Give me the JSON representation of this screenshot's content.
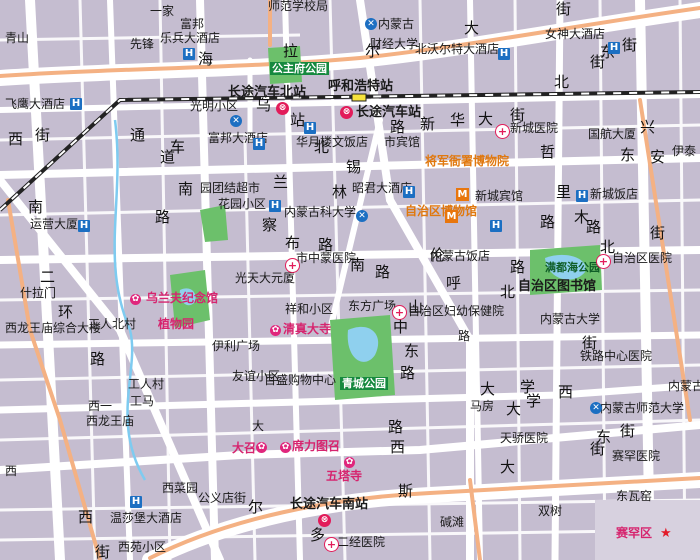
{
  "colors": {
    "block": "#c5bdd0",
    "road": "#ffffff",
    "arterial": "#f4b183",
    "water": "#8fd0ee",
    "park": "#6cc06b",
    "rail": "#222222",
    "canal": "#7ecbf0"
  },
  "roads": {
    "hailaer": [
      "海",
      "拉",
      "尔",
      "大",
      "街"
    ],
    "hailaer_east": [
      "东",
      "街"
    ],
    "xinhua": [
      "新",
      "华",
      "大",
      "街"
    ],
    "zhongshan": [
      "中",
      "山",
      "东",
      "路"
    ],
    "daxue": [
      "大",
      "学",
      "东",
      "街"
    ],
    "nan_erhuan": [
      "南",
      "二",
      "环",
      "路"
    ],
    "erdong": [
      "尔",
      "多",
      "斯",
      "大",
      "街"
    ],
    "xinhua_west": [
      "西",
      "街"
    ],
    "tongdao": [
      "通",
      "道",
      "南",
      "路"
    ],
    "wulanchabu": [
      "乌",
      "兰",
      "察",
      "布",
      "路"
    ],
    "shiyan": [
      "锡",
      "林",
      "南",
      "路"
    ],
    "xilin_west": [
      "西",
      "街"
    ],
    "huang": [
      "西",
      "路"
    ],
    "dongfeng": [
      "大",
      "学",
      "西",
      "街"
    ],
    "hulunbeier": [
      "呼",
      "伦",
      "北",
      "路"
    ],
    "zhelimu": [
      "哲",
      "里",
      "木",
      "路"
    ],
    "xingan": [
      "兴",
      "安",
      "北",
      "路"
    ],
    "beijing": [
      "北",
      "街"
    ],
    "nan_che": [
      "车",
      "站",
      "北",
      "路"
    ],
    "ruyi": [
      "东",
      "街"
    ]
  },
  "places": {
    "qingshan": "青山",
    "yijia": "一家",
    "xianfeng": "先锋",
    "fubang": "富邦",
    "lebing": "乐兵大酒店",
    "shifan": "师范学校局",
    "neimenggu": "内蒙古",
    "caijing": "财经大学",
    "nvshen": "女神大酒店",
    "hawo": "北沃尔特大酒店",
    "feiying": "飞鹰大酒店",
    "guangming": "光明小区",
    "huhehaote_station": "呼和浩特站",
    "changtu_bei": "长途汽车北站",
    "changtu": "长途汽车站",
    "gongzhufu": "公主府公园",
    "xincheng_yy": "新城医院",
    "guohang": "国航大厦",
    "yiji": "伊泰",
    "fubang2": "富邦大酒店",
    "hualou": "华月楼文饭店",
    "shibin": "市宾馆",
    "jiangjun": "将军衙署博物院",
    "xincheng_bg": "新城宾馆",
    "xincheng_fd": "新城饭店",
    "zhaojun": "昭君大酒店",
    "nmgkj": "内蒙古科大学",
    "zizhiqu_bwg": "自治区博物馆",
    "jiaotong": "运营大厦",
    "huayuan": "花园小区",
    "gongyuan": "园团结超市",
    "nmg_fd": "内蒙古饭店",
    "manduhai": "满都海公园",
    "zizhiqu_yy": "自治区医院",
    "zizhiqu_tsg": "自治区图书馆",
    "shizhongmeng": "市中蒙医院",
    "ulanfu": "乌兰夫纪念馆",
    "zhiwuyuan": "植物园",
    "guangtian": "光天大元厦",
    "xiangoe": "祥和小区",
    "dongfang": "东方广场",
    "fubao": "自治区妇幼保健院",
    "nmg_daxue": "内蒙古大学",
    "zhalan": "什拉门",
    "xilong": "西龙王庙综合大楼",
    "gongren": "工人北村",
    "yili": "伊利广场",
    "qingzhensi": "清真大寺",
    "tieluzx": "铁路中心医院",
    "youyi": "友谊小区",
    "baisheng": "百盛购物中心",
    "qingcheng": "青城公园",
    "nmg_shida": "内蒙古师范大学",
    "gongrenbeijie": "工人村",
    "xilong2": "西龙王庙",
    "tianjiao": "天骄医院",
    "saihan": "赛罕医院",
    "dazhao": "大召",
    "xilituzhao": "席力图召",
    "wutasi": "五塔寺",
    "dongwa": "东瓦窑",
    "changtu_nan": "长途汽车南站",
    "erfujing": "二经医院",
    "wenquan": "温莎堡大酒店",
    "xicai": "西菜园",
    "gongyi": "公义店街",
    "saihan_qu": "赛罕区",
    "jiancai": "碱滩",
    "shuanghe": "双树",
    "xiyuan": "西苑小区",
    "gongma": "工马",
    "xiyi": "西一",
    "da": "大",
    "xi": "西",
    "mafang": "马房",
    "lu": "路",
    "neimeng_bottom": "内蒙古"
  }
}
